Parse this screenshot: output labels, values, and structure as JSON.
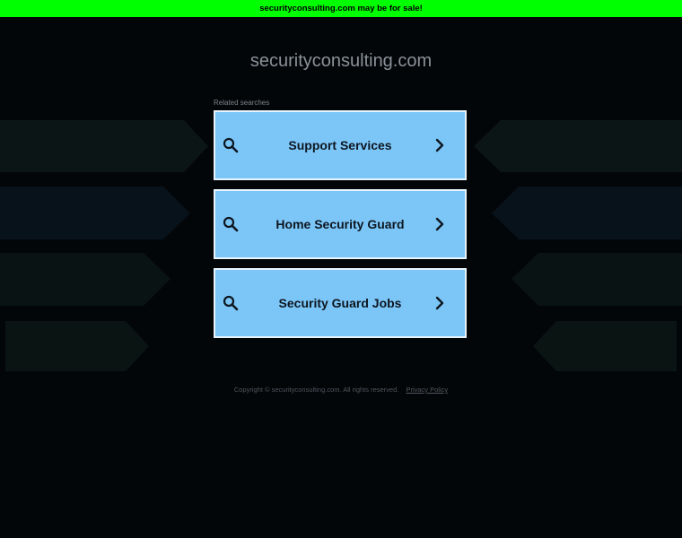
{
  "banner": {
    "text": "securityconsulting.com may be for sale!"
  },
  "header": {
    "domain": "securityconsulting.com"
  },
  "related": {
    "label": "Related searches",
    "items": [
      {
        "label": "Support Services",
        "icon": "search-icon",
        "arrow": "chevron-right-icon"
      },
      {
        "label": "Home Security Guard",
        "icon": "search-icon",
        "arrow": "chevron-right-icon"
      },
      {
        "label": "Security Guard Jobs",
        "icon": "search-icon",
        "arrow": "chevron-right-icon"
      }
    ]
  },
  "footer": {
    "copyright": "Copyright © securityconsulting.com.  All rights reserved.",
    "privacy": "Privacy Policy"
  },
  "colors": {
    "background": "#030609",
    "banner": "#00ff00",
    "box": "#7cc6f7",
    "box_border": "#e8f4fc"
  }
}
